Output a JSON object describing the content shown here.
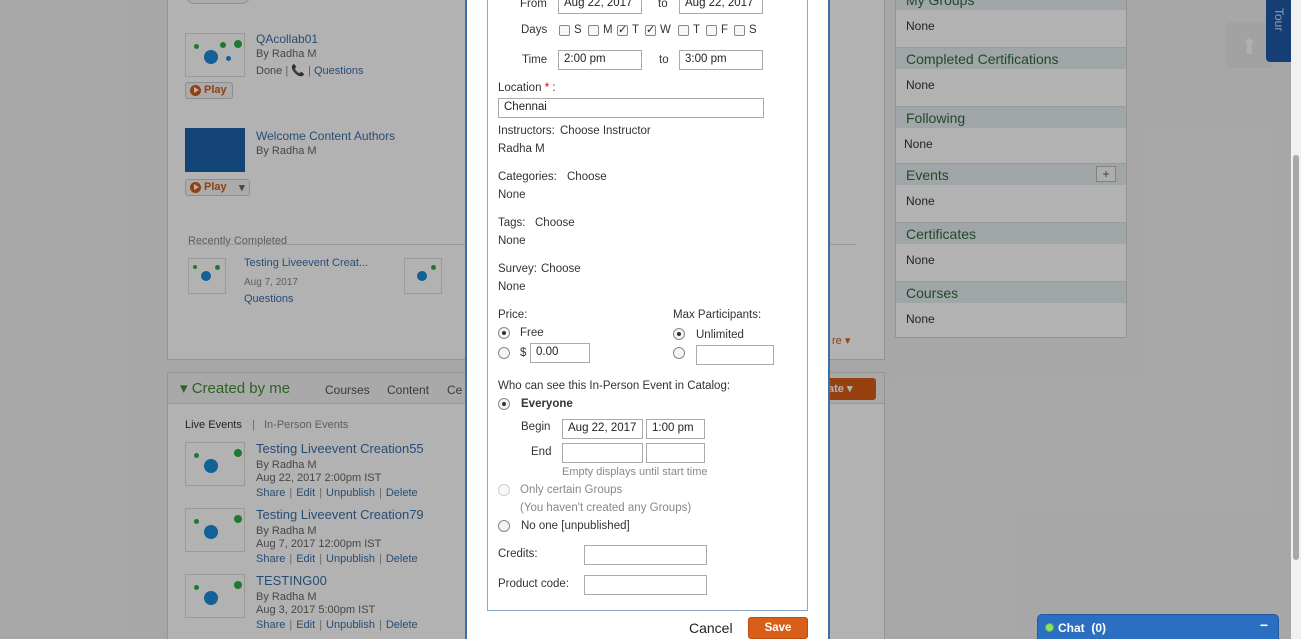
{
  "background": {
    "top_list": [
      {
        "title": "QAcollab01",
        "by": "By Radha M",
        "status": "Done",
        "questions": "Questions",
        "play": "Play"
      },
      {
        "title": "Welcome Content Authors",
        "by": "By Radha M",
        "play": "Play"
      }
    ],
    "recently_completed": {
      "heading": "Recently Completed",
      "items": [
        {
          "title": "Testing Liveevent Creat...",
          "date": "Aug 7, 2017",
          "link": "Questions"
        }
      ],
      "more": "re"
    },
    "created_by_me": {
      "title": "Created by me",
      "tabs": [
        "Courses",
        "Content",
        "Ce"
      ],
      "create_label": "ate",
      "subtabs": [
        "Live Events",
        "In-Person Events"
      ],
      "items": [
        {
          "title": "Testing Liveevent Creation55",
          "by": "By Radha M",
          "date": "Aug 22, 2017 2:00pm IST",
          "links": [
            "Share",
            "Edit",
            "Unpublish",
            "Delete"
          ]
        },
        {
          "title": "Testing Liveevent Creation79",
          "by": "By Radha M",
          "date": "Aug 7, 2017 12:00pm IST",
          "links": [
            "Share",
            "Edit",
            "Unpublish",
            "Delete"
          ]
        },
        {
          "title": "TESTING00",
          "by": "By Radha M",
          "date": "Aug 3, 2017 5:00pm IST",
          "links": [
            "Share",
            "Edit",
            "Unpublish",
            "Delete"
          ]
        }
      ]
    },
    "sidebar": [
      {
        "title": "My Groups",
        "value": "None"
      },
      {
        "title": "Completed Certifications",
        "value": "None"
      },
      {
        "title": "Following",
        "value": "None"
      },
      {
        "title": "Events",
        "value": "None",
        "add": "+"
      },
      {
        "title": "Certificates",
        "value": "None"
      },
      {
        "title": "Courses",
        "value": "None"
      }
    ],
    "tour": "Tour"
  },
  "modal": {
    "from_label": "From",
    "from_date": "Aug 22, 2017",
    "to_label": "to",
    "to_date": "Aug 22, 2017",
    "days_label": "Days",
    "days": [
      {
        "label": "S",
        "checked": false
      },
      {
        "label": "M",
        "checked": false
      },
      {
        "label": "T",
        "checked": true
      },
      {
        "label": "W",
        "checked": true
      },
      {
        "label": "T",
        "checked": false
      },
      {
        "label": "F",
        "checked": false
      },
      {
        "label": "S",
        "checked": false
      }
    ],
    "time_label": "Time",
    "time_from": "2:00 pm",
    "time_to_label": "to",
    "time_to": "3:00 pm",
    "location_label": "Location",
    "location_req": "*",
    "location_colon": ":",
    "location_value": "Chennai",
    "instructors_label": "Instructors:",
    "instructors_link": "Choose Instructor",
    "instructors_value": "Radha M",
    "categories_label": "Categories:",
    "categories_link": "Choose",
    "categories_value": "None",
    "tags_label": "Tags:",
    "tags_link": "Choose",
    "tags_value": "None",
    "survey_label": "Survey:",
    "survey_link": "Choose",
    "survey_value": "None",
    "price_label": "Price:",
    "price_free": "Free",
    "price_currency": "$",
    "price_value": "0.00",
    "max_label": "Max Participants:",
    "max_unlimited": "Unlimited",
    "max_value": "",
    "visibility_label": "Who can see this In-Person Event in Catalog:",
    "everyone_label": "Everyone",
    "begin_label": "Begin",
    "begin_date": "Aug 22, 2017",
    "begin_time": "1:00 pm",
    "end_label": "End",
    "end_date": "",
    "end_time": "",
    "end_hint": "Empty displays until start time",
    "groups_label": "Only certain Groups",
    "groups_hint": "(You haven't created any Groups)",
    "noone_label": "No one [unpublished]",
    "credits_label": "Credits:",
    "credits_value": "",
    "product_label": "Product code:",
    "product_value": "",
    "cancel_label": "Cancel",
    "save_label": "Save"
  },
  "chat": {
    "label": "Chat",
    "count": "(0)",
    "minimize": "−"
  },
  "colors": {
    "accent": "#3a6fa8",
    "save": "#d95e17",
    "chat": "#2a6fc1",
    "green": "#3f8f2f"
  }
}
